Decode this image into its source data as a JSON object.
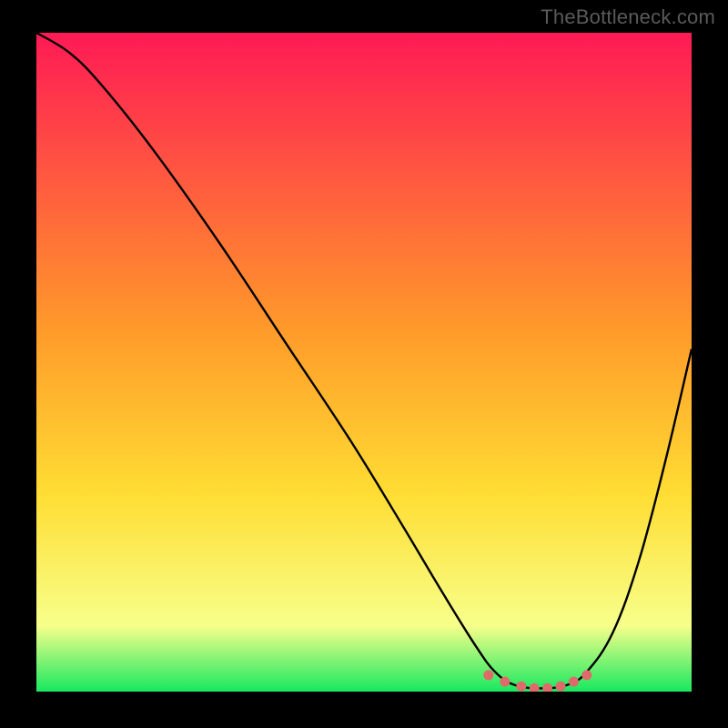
{
  "watermark": "TheBottleneck.com",
  "colors": {
    "gradient_top": "#ff1a55",
    "gradient_mid": "#ffdd33",
    "gradient_low": "#f7ff8a",
    "gradient_bottom": "#18e860",
    "curve": "#000000",
    "marker": "#e06a6a",
    "background": "#000000"
  },
  "chart_data": {
    "type": "line",
    "title": "",
    "xlabel": "",
    "ylabel": "",
    "xlim": [
      0,
      100
    ],
    "ylim": [
      0,
      100
    ],
    "series": [
      {
        "name": "curve",
        "x": [
          0,
          5,
          10,
          18,
          28,
          38,
          48,
          56,
          62,
          67,
          70,
          73,
          77,
          81,
          84,
          88,
          92,
          96,
          100
        ],
        "y": [
          100,
          97,
          92,
          82,
          68,
          53,
          38,
          25,
          15,
          7,
          3,
          1,
          0.5,
          1,
          3,
          9,
          20,
          35,
          52
        ]
      }
    ],
    "markers": {
      "name": "bottom-points",
      "x": [
        69,
        71.5,
        74,
        76,
        78,
        80,
        82,
        84
      ],
      "y": [
        2.5,
        1.5,
        0.8,
        0.5,
        0.5,
        0.8,
        1.5,
        2.5
      ]
    }
  }
}
